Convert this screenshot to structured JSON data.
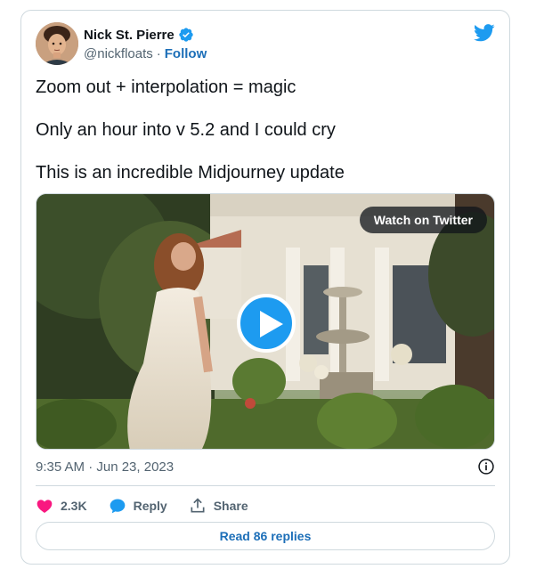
{
  "author": {
    "display_name": "Nick St. Pierre",
    "handle": "@nickfloats",
    "separator": "·",
    "follow_label": "Follow",
    "verified": true
  },
  "tweet": {
    "lines": [
      "Zoom out + interpolation = magic",
      "Only an hour into v 5.2 and I could cry",
      "This is an incredible Midjourney update"
    ]
  },
  "media": {
    "watch_label": "Watch on Twitter"
  },
  "meta": {
    "timestamp": "9:35 AM · Jun 23, 2023"
  },
  "actions": {
    "like_count": "2.3K",
    "reply_label": "Reply",
    "share_label": "Share"
  },
  "footer": {
    "read_replies_label": "Read 86 replies"
  },
  "colors": {
    "brand": "#1d9bf0",
    "link": "#1d6fb8",
    "like": "#f91880",
    "muted": "#536471",
    "border": "#cfd9de"
  },
  "icons": [
    "verified-badge-icon",
    "twitter-bird-icon",
    "play-icon",
    "info-icon",
    "heart-icon",
    "reply-icon",
    "share-icon"
  ]
}
